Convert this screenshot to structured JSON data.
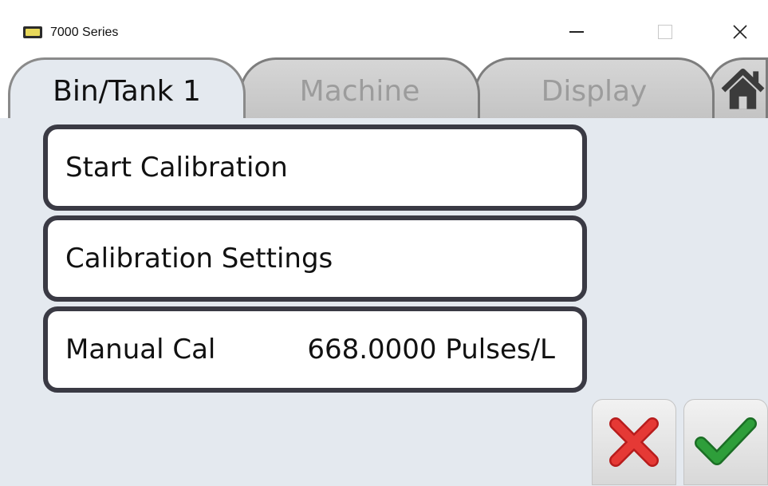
{
  "window": {
    "title": "7000 Series",
    "minimize_label": "minimize",
    "maximize_label": "maximize",
    "close_label": "close"
  },
  "tabs": [
    {
      "label": "Bin/Tank 1",
      "active": true
    },
    {
      "label": "Machine",
      "active": false
    },
    {
      "label": "Display",
      "active": false
    }
  ],
  "home_tab": {
    "icon": "home-icon"
  },
  "menu": {
    "start_calibration": "Start Calibration",
    "calibration_settings": "Calibration Settings",
    "manual_cal_label": "Manual Cal",
    "manual_cal_value": "668.0000 Pulses/L"
  },
  "actions": {
    "cancel_icon": "red-x-icon",
    "confirm_icon": "green-check-icon"
  },
  "colors": {
    "background": "#e4e9ef",
    "button_border": "#3a3a44",
    "cancel_red": "#e53935",
    "confirm_green": "#2e9e3a",
    "inactive_tab": "#c4c4c4"
  }
}
